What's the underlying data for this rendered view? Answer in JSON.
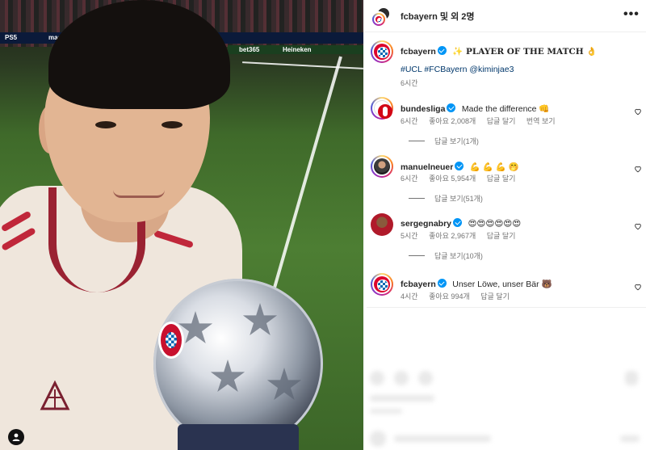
{
  "header": {
    "username": "fcbayern",
    "and_others": "및 외 2명",
    "more": "•••"
  },
  "photo": {
    "ads": [
      "PS5",
      "mastercard",
      "bet365",
      "Heineken"
    ]
  },
  "caption": {
    "username": "fcbayern",
    "title": "✨ PLAYER OF THE MATCH 👌",
    "hashtags": "#UCL #FCBayern @kiminjae3",
    "time": "6시간"
  },
  "comments": [
    {
      "username": "bundesliga",
      "text": "Made the difference 👊",
      "time": "6시간",
      "likes": "좋아요 2,008개",
      "reply": "답글 달기",
      "translate": "번역 보기",
      "view_replies": "답글 보기(1개)"
    },
    {
      "username": "manuelneuer",
      "text": "💪 💪 💪 🤭",
      "time": "6시간",
      "likes": "좋아요 5,954개",
      "reply": "답글 달기",
      "view_replies": "답글 보기(51개)"
    },
    {
      "username": "sergegnabry",
      "text": "😍😍😍😍😍😍",
      "time": "5시간",
      "likes": "좋아요 2,967개",
      "reply": "답글 달기",
      "view_replies": "답글 보기(10개)"
    },
    {
      "username": "fcbayern",
      "text": "Unser Löwe, unser Bär 🐻",
      "time": "4시간",
      "likes": "좋아요 994개",
      "reply": "답글 달기"
    }
  ],
  "colors": {
    "link": "#00376b",
    "verified": "#0095f6",
    "muted": "#737373",
    "bayern_red": "#dc052d"
  }
}
